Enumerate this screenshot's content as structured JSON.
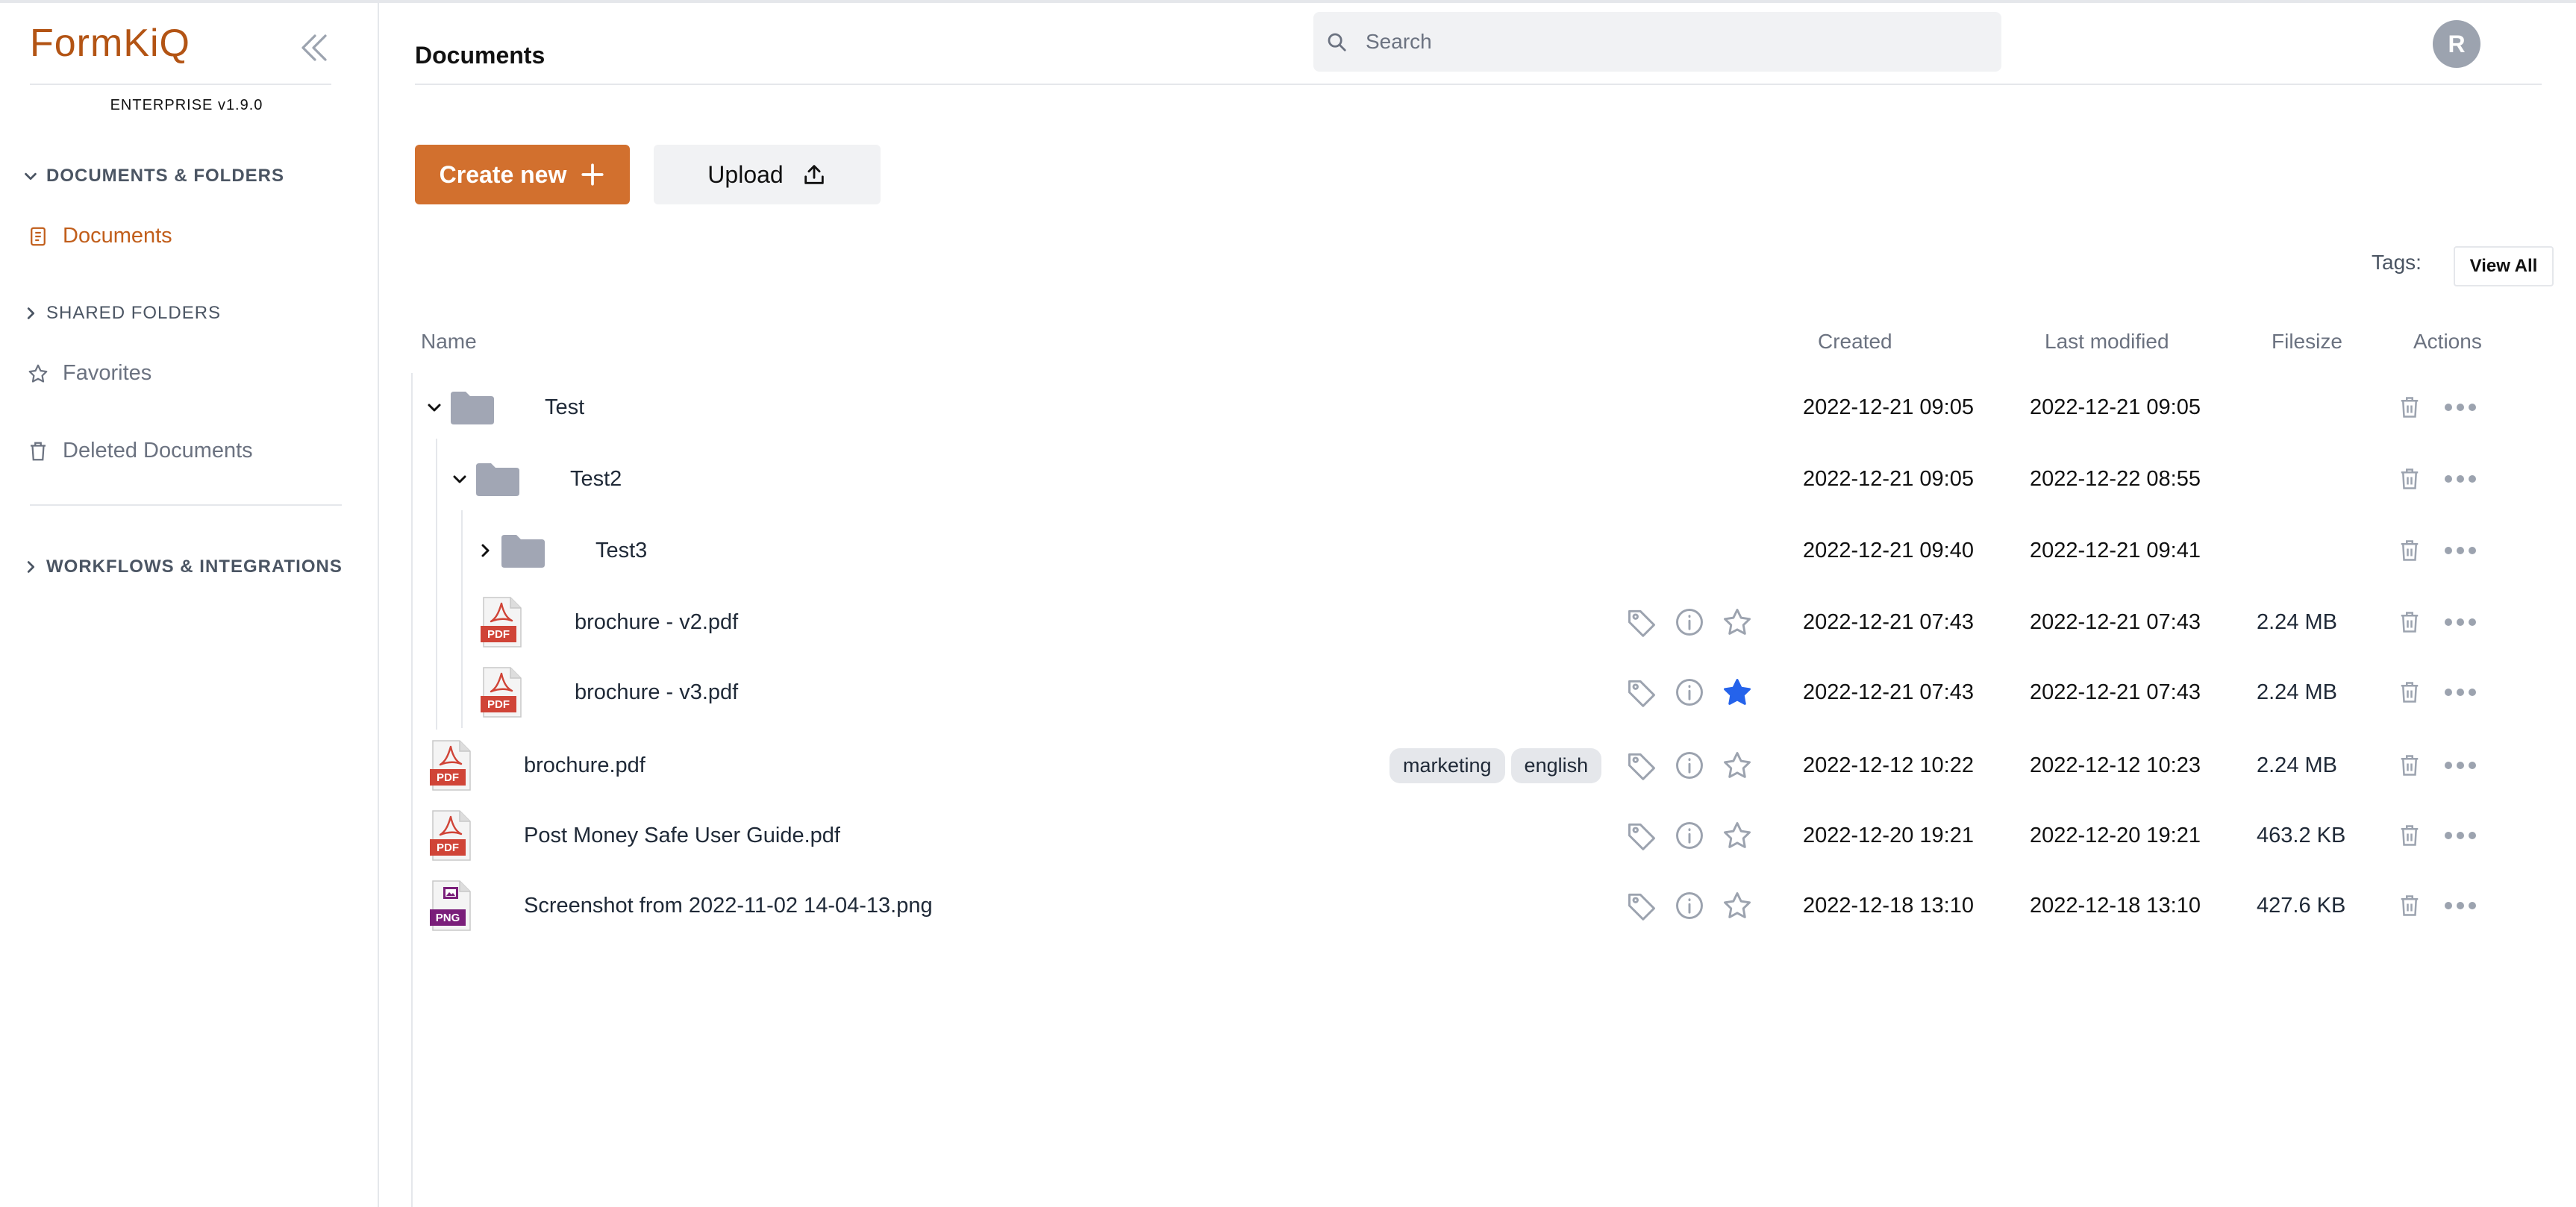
{
  "app": {
    "logo": "FormKiQ",
    "edition": "ENTERPRISE v1.9.0",
    "brand_color": "#c15e1b"
  },
  "sidebar": {
    "sections": [
      {
        "label": "DOCUMENTS & FOLDERS",
        "expanded": true
      },
      {
        "label": "SHARED FOLDERS",
        "expanded": false
      },
      {
        "label": "WORKFLOWS & INTEGRATIONS",
        "expanded": false
      }
    ],
    "items": [
      {
        "label": "Documents",
        "icon": "document-icon",
        "active": true
      },
      {
        "label": "Favorites",
        "icon": "star-icon",
        "active": false
      },
      {
        "label": "Deleted Documents",
        "icon": "trash-icon",
        "active": false
      }
    ]
  },
  "header": {
    "title": "Documents",
    "search_placeholder": "Search",
    "avatar_initial": "R"
  },
  "toolbar": {
    "create_label": "Create new",
    "upload_label": "Upload",
    "tags_label": "Tags:",
    "view_all_label": "View All"
  },
  "table": {
    "columns": [
      "Name",
      "Created",
      "Last modified",
      "Filesize",
      "Actions"
    ],
    "rows": [
      {
        "name": "Test",
        "type": "folder",
        "expanded": true,
        "created": "2022-12-21 09:05",
        "modified": "2022-12-21 09:05",
        "size": "",
        "tags": [],
        "favorite": false
      },
      {
        "name": "Test2",
        "type": "folder",
        "expanded": true,
        "created": "2022-12-21 09:05",
        "modified": "2022-12-22 08:55",
        "size": "",
        "tags": [],
        "favorite": false
      },
      {
        "name": "Test3",
        "type": "folder",
        "expanded": false,
        "created": "2022-12-21 09:40",
        "modified": "2022-12-21 09:41",
        "size": "",
        "tags": [],
        "favorite": false
      },
      {
        "name": "brochure - v2.pdf",
        "type": "pdf",
        "created": "2022-12-21 07:43",
        "modified": "2022-12-21 07:43",
        "size": "2.24 MB",
        "tags": [],
        "favorite": false
      },
      {
        "name": "brochure - v3.pdf",
        "type": "pdf",
        "created": "2022-12-21 07:43",
        "modified": "2022-12-21 07:43",
        "size": "2.24 MB",
        "tags": [],
        "favorite": true
      },
      {
        "name": "brochure.pdf",
        "type": "pdf",
        "created": "2022-12-12 10:22",
        "modified": "2022-12-12 10:23",
        "size": "2.24 MB",
        "tags": [
          "marketing",
          "english"
        ],
        "favorite": false
      },
      {
        "name": "Post Money Safe User Guide.pdf",
        "type": "pdf",
        "created": "2022-12-20 19:21",
        "modified": "2022-12-20 19:21",
        "size": "463.2 KB",
        "tags": [],
        "favorite": false
      },
      {
        "name": "Screenshot from 2022-11-02 14-04-13.png",
        "type": "png",
        "created": "2022-12-18 13:10",
        "modified": "2022-12-18 13:10",
        "size": "427.6 KB",
        "tags": [],
        "favorite": false
      }
    ],
    "file_type_labels": {
      "pdf": "PDF",
      "png": "PNG"
    },
    "favorite_color": "#2563eb"
  }
}
